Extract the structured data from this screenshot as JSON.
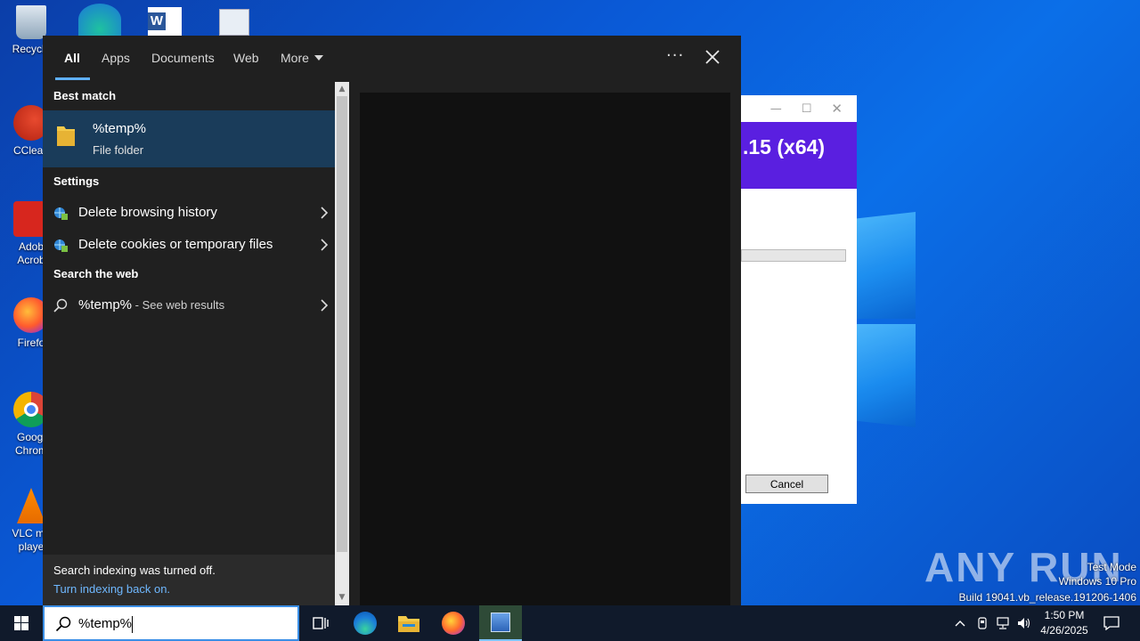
{
  "search_panel": {
    "tabs": [
      {
        "label": "All"
      },
      {
        "label": "Apps"
      },
      {
        "label": "Documents"
      },
      {
        "label": "Web"
      },
      {
        "label": "More"
      }
    ],
    "best_match_header": "Best match",
    "best_match": {
      "title": "%temp%",
      "subtitle": "File folder"
    },
    "settings_header": "Settings",
    "settings_items": [
      {
        "label": "Delete browsing history"
      },
      {
        "label": "Delete cookies or temporary files"
      }
    ],
    "web_header": "Search the web",
    "web_item": {
      "query": "%temp%",
      "suffix": " - See web results"
    },
    "footer": {
      "status": "Search indexing was turned off.",
      "link": "Turn indexing back on."
    }
  },
  "taskbar": {
    "search_value": "%temp%",
    "clock_time": "1:50 PM",
    "clock_date": "4/26/2025"
  },
  "desktop_icons": [
    {
      "label": "Recycle",
      "icon": "recycle-bin-icon"
    },
    {
      "label": "CClean",
      "icon": "ccleaner-icon"
    },
    {
      "label": "Adob",
      "label2": "Acrob",
      "icon": "acrobat-icon"
    },
    {
      "label": "Firefo",
      "icon": "firefox-icon"
    },
    {
      "label": "Googl",
      "label2": "Chrom",
      "icon": "chrome-icon"
    },
    {
      "label": "VLC me",
      "label2": "playe",
      "icon": "vlc-icon"
    }
  ],
  "installer": {
    "banner_text": ".15 (x64)",
    "cancel_label": "Cancel"
  },
  "watermark": {
    "brand": "ANY RUN",
    "mode": "Test Mode",
    "edition": "Windows 10 Pro",
    "build": "Build 19041.vb_release.191206-1406"
  },
  "colors": {
    "accent": "#5fb0ff",
    "selection": "#1a3c5a",
    "panel_bg": "#202020",
    "installer_banner": "#5a1fe0"
  }
}
